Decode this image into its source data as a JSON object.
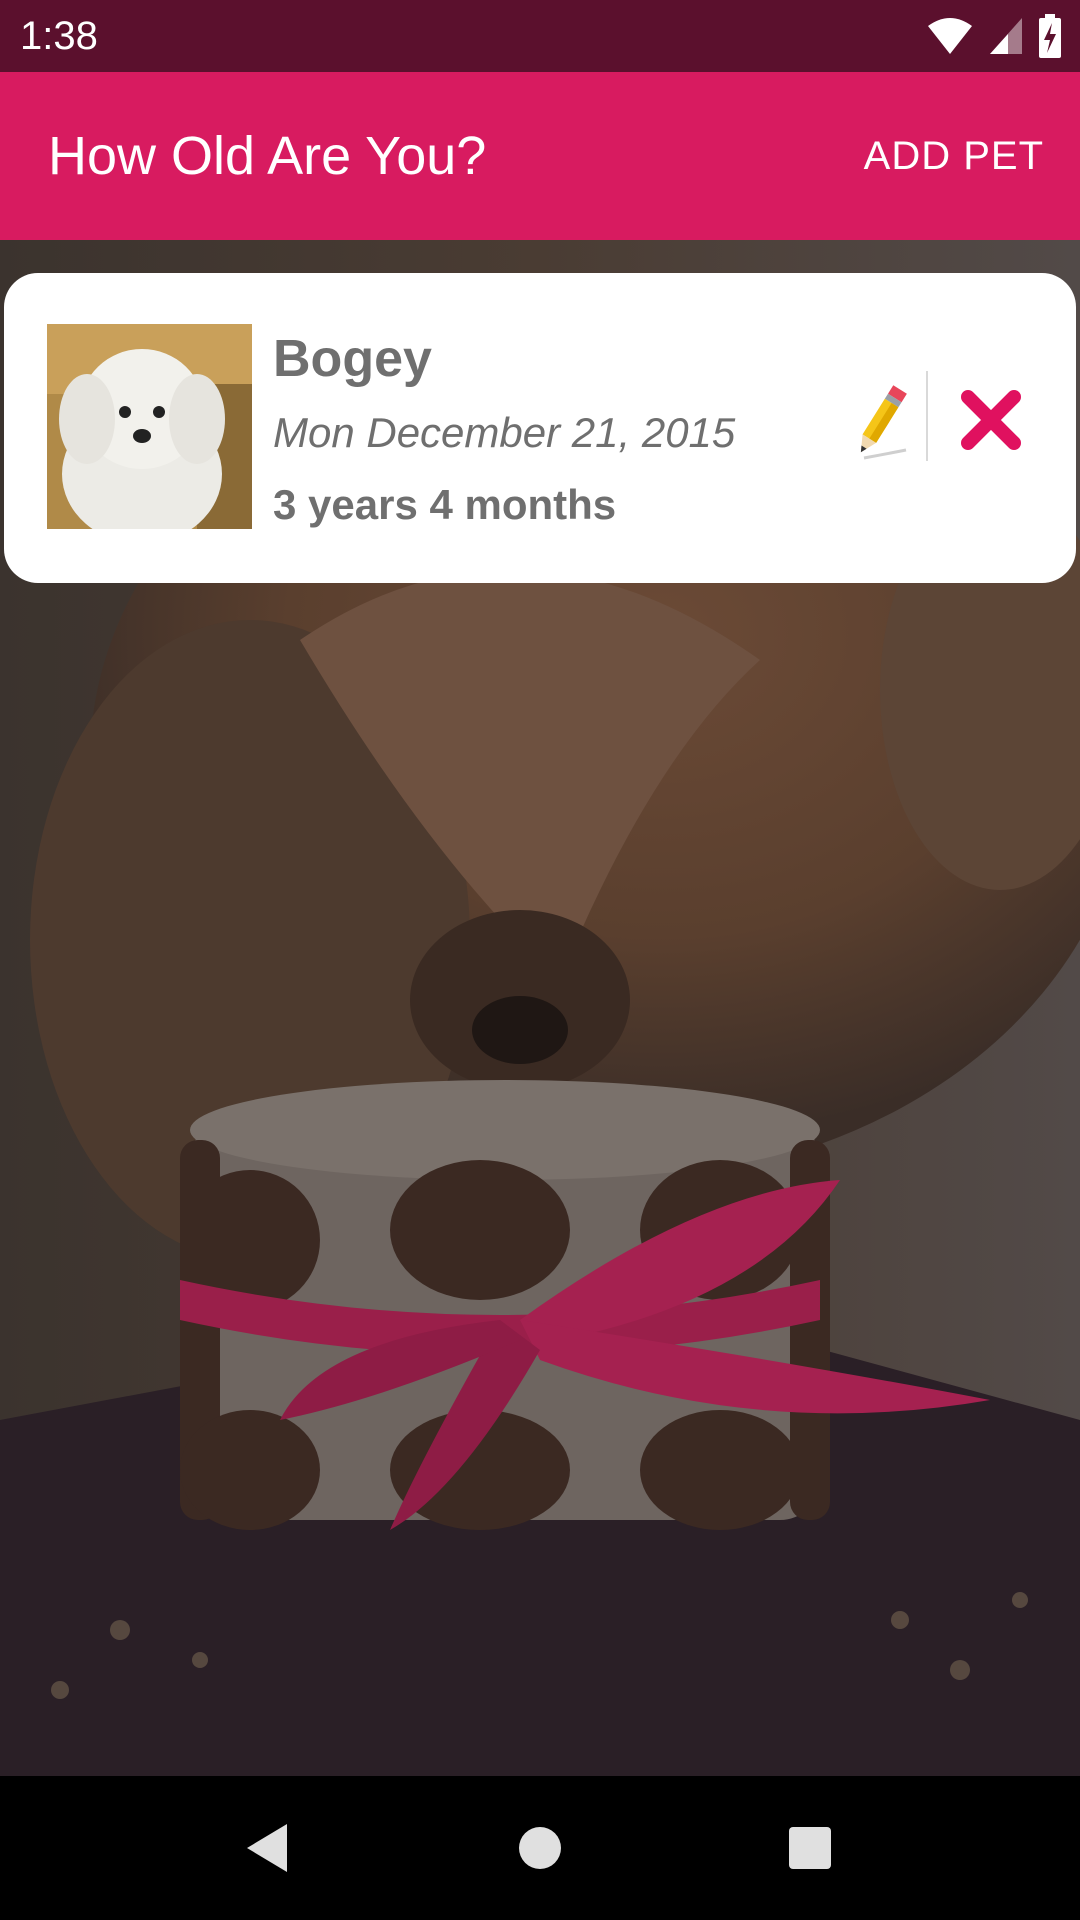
{
  "status_bar": {
    "time": "1:38",
    "icons": [
      "wifi-icon",
      "signal-icon",
      "battery-charging-icon"
    ]
  },
  "app_bar": {
    "title": "How Old Are You?",
    "add_pet_label": "ADD PET",
    "color": "#d81b60"
  },
  "pets": [
    {
      "name": "Bogey",
      "birthdate": "Mon December 21, 2015",
      "age": "3 years 4 months",
      "photo": "white-poodle-photo",
      "edit_icon": "pencil-icon",
      "delete_icon": "close-icon"
    }
  ],
  "background": {
    "photo": "dog-eating-birthday-cake-photo"
  },
  "nav_bar": {
    "icons": [
      "back-icon",
      "home-icon",
      "recents-icon"
    ]
  },
  "colors": {
    "status_bar": "#5b102d",
    "accent": "#d81b60",
    "delete": "#e0115f"
  }
}
